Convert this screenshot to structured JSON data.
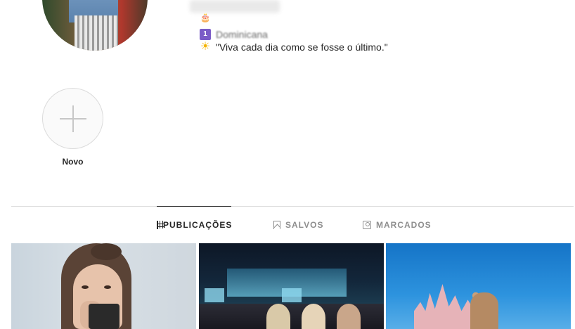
{
  "profile": {
    "avatar_alt": "profile-photo",
    "bio": {
      "location": "Dominicana",
      "quote": "\"Viva cada dia como se fosse o último.\""
    }
  },
  "highlights": {
    "new_label": "Novo"
  },
  "tabs": [
    {
      "label": "PUBLICAÇÕES",
      "icon": "grid-icon",
      "active": true
    },
    {
      "label": "SALVOS",
      "icon": "bookmark-icon",
      "active": false
    },
    {
      "label": "MARCADOS",
      "icon": "tag-icon",
      "active": false
    }
  ],
  "colors": {
    "text_primary": "#262626",
    "text_secondary": "#8e8e8e",
    "divider": "#dbdbdb",
    "active_tab_border": "#262626"
  }
}
